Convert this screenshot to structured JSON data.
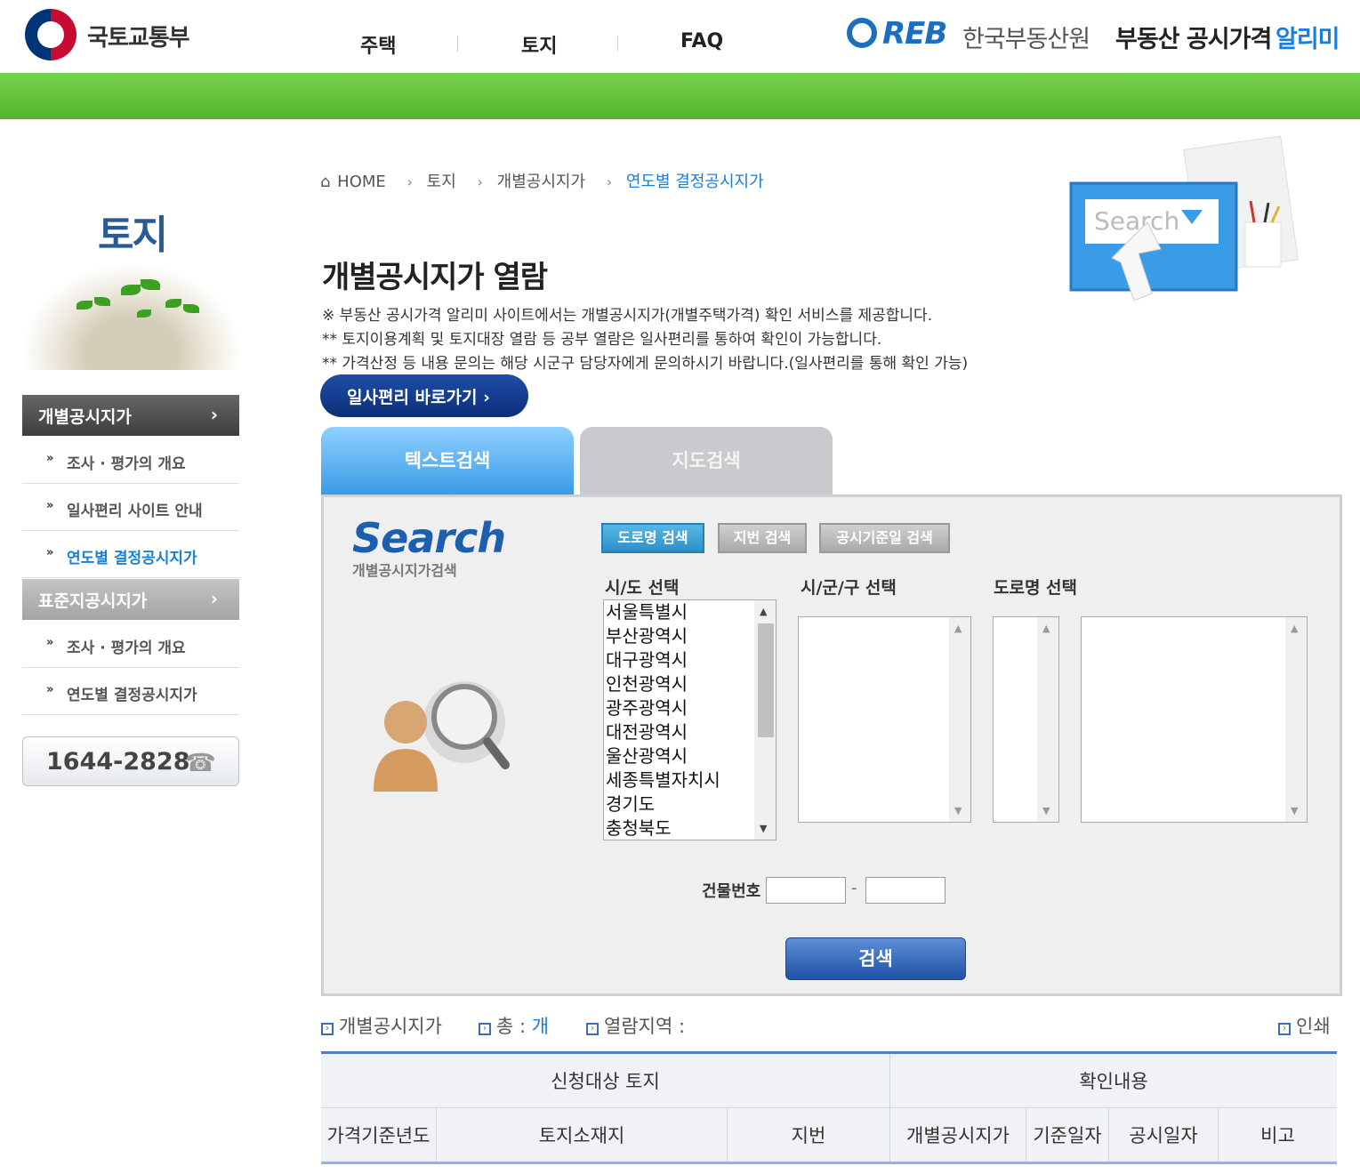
{
  "header": {
    "ministry_name": "국토교통부",
    "nav": [
      "주택",
      "토지",
      "FAQ"
    ],
    "reb_text": "REB",
    "reb_org": "한국부동산원",
    "reb_service": "부동산 공시가격",
    "reb_service_accent": "알리미"
  },
  "sidebar": {
    "title": "토지",
    "sections": [
      {
        "label": "개별공시지가",
        "items": [
          "조사 · 평가의 개요",
          "일사편리 사이트 안내",
          "연도별 결정공시지가"
        ],
        "active_item": 2
      },
      {
        "label": "표준지공시지가",
        "items": [
          "조사 · 평가의 개요",
          "연도별 결정공시지가"
        ]
      }
    ],
    "phone": "1644-2828"
  },
  "breadcrumb": [
    "HOME",
    "토지",
    "개별공시지가",
    "연도별 결정공시지가"
  ],
  "page_title": "개별공시지가 열람",
  "notices": [
    "※ 부동산 공시가격 알리미 사이트에서는 개별공시지가(개별주택가격) 확인 서비스를 제공합니다.",
    "** 토지이용계획 및 토지대장 열람 등 공부 열람은 일사편리를 통하여 확인이 가능합니다.",
    "** 가격산정 등 내용 문의는 해당 시군구 담당자에게 문의하시기 바랍니다.(일사편리를 통해 확인 가능)"
  ],
  "shortcut_button": "일사편리 바로가기  ›",
  "tabs": [
    "텍스트검색",
    "지도검색"
  ],
  "illustration_text": "Search",
  "search": {
    "logo": "Search",
    "subtitle": "개별공시지가검색",
    "type_buttons": [
      "도로명 검색",
      "지번 검색",
      "공시기준일 검색"
    ],
    "labels": {
      "sido": "시/도 선택",
      "sigungu": "시/군/구 선택",
      "road": "도로명 선택"
    },
    "sido_options": [
      "서울특별시",
      "부산광역시",
      "대구광역시",
      "인천광역시",
      "광주광역시",
      "대전광역시",
      "울산광역시",
      "세종특별자치시",
      "경기도",
      "충청북도"
    ],
    "building_label": "건물번호",
    "building_dash": "-",
    "search_button": "검색"
  },
  "info": {
    "kind": "개별공시지가",
    "total_label": "총 :",
    "total_unit": "개",
    "region_label": "열람지역 :",
    "print": "인쇄"
  },
  "table": {
    "group_headers": [
      "신청대상 토지",
      "확인내용"
    ],
    "columns": [
      "가격기준년도",
      "토지소재지",
      "지번",
      "개별공시지가",
      "기준일자",
      "공시일자",
      "비고"
    ]
  },
  "colors": {
    "green_bar": "#5cbf32",
    "accent_blue": "#1a7fd8",
    "dark_blue": "#0c2e78"
  }
}
